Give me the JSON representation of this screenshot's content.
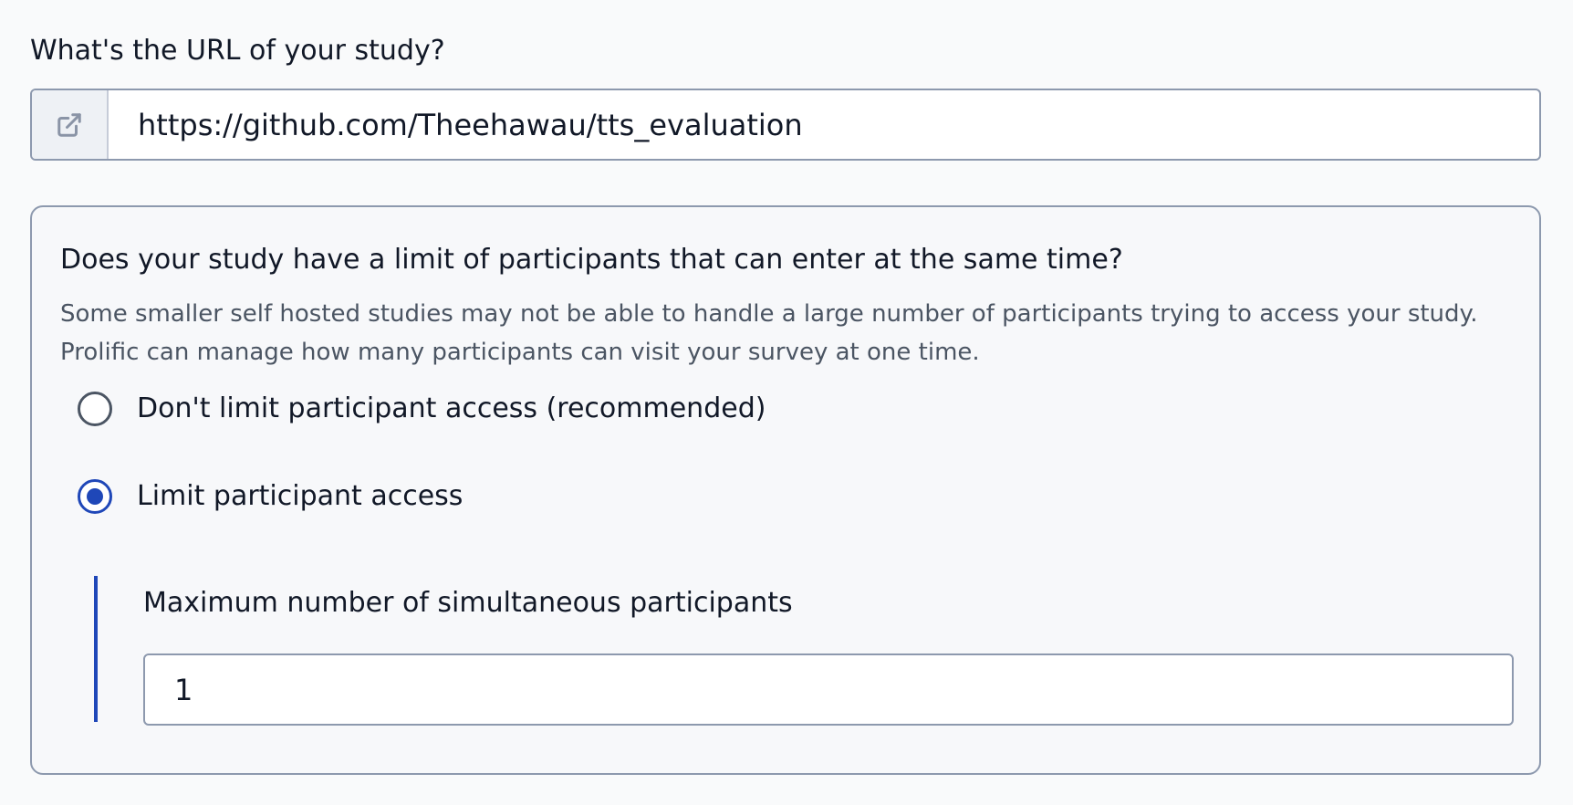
{
  "url_section": {
    "label": "What's the URL of your study?",
    "icon": "external-link-icon",
    "value": "https://github.com/Theehawau/tts_evaluation"
  },
  "limit_section": {
    "title": "Does your study have a limit of participants that can enter at the same time?",
    "description": "Some smaller self hosted studies may not be able to handle a large number of participants trying to access your study. Prolific can manage how many participants can visit your survey at one time.",
    "options": [
      {
        "label": "Don't limit participant access (recommended)",
        "selected": false
      },
      {
        "label": "Limit participant access",
        "selected": true
      }
    ],
    "max_participants": {
      "label": "Maximum number of simultaneous participants",
      "value": "1"
    }
  },
  "colors": {
    "accent": "#1f47b8",
    "border": "#8d99ae",
    "background": "#f9fafb"
  }
}
